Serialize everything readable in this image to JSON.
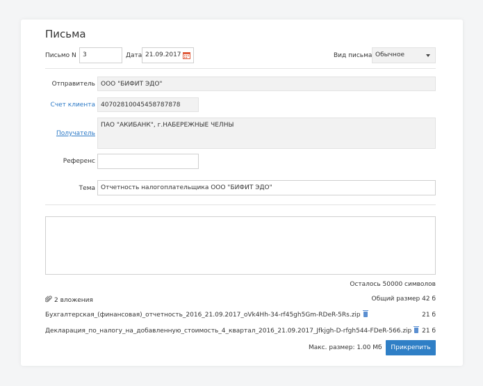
{
  "page": {
    "title": "Письма"
  },
  "header_row": {
    "letter_no_label": "Письмо N",
    "letter_no_value": "3",
    "date_label": "Дата",
    "date_value": "21.09.2017",
    "type_label": "Вид письма",
    "type_value": "Обычное"
  },
  "fields": {
    "sender_label": "Отправитель",
    "sender_value": "ООО \"БИФИТ ЭДО\"",
    "account_label": "Счет клиента",
    "account_value": "40702810045458787878",
    "recipient_label": "Получатель",
    "recipient_value": "ПАО \"АКИБАНК\", г.НАБЕРЕЖНЫЕ ЧЕЛНЫ",
    "reference_label": "Референс",
    "reference_value": "",
    "subject_label": "Тема",
    "subject_value": "Отчетность налогоплательщика ООО \"БИФИТ ЭДО\""
  },
  "body": {
    "text": "",
    "remaining": "Осталось 50000 символов"
  },
  "attachments": {
    "count_label": "2 вложения",
    "total_size": "Общий размер 42 б",
    "files": [
      {
        "name": "Бухгалтерская_(финансовая)_отчетность_2016_21.09.2017_oVk4Hh-34-rf45gh5Gm-RDeR-5Rs.zip",
        "size": "21 б"
      },
      {
        "name": "Декларация_по_налогу_на_добавленную_стоимость_4_квартал_2016_21.09.2017_Jfkjgh-D-rfgh544-FDeR-566.zip",
        "size": "21 б"
      }
    ],
    "max_size": "Макс. размер: 1.00 Мб",
    "attach_button": "Прикрепить"
  },
  "colors": {
    "accent": "#2f7fc6",
    "link": "#2a78c6",
    "calendar": "#e05a3a"
  },
  "icons": {
    "calendar": "calendar-icon",
    "paperclip": "paperclip-icon",
    "trash": "trash-icon",
    "dropdown": "chevron-down-icon"
  }
}
